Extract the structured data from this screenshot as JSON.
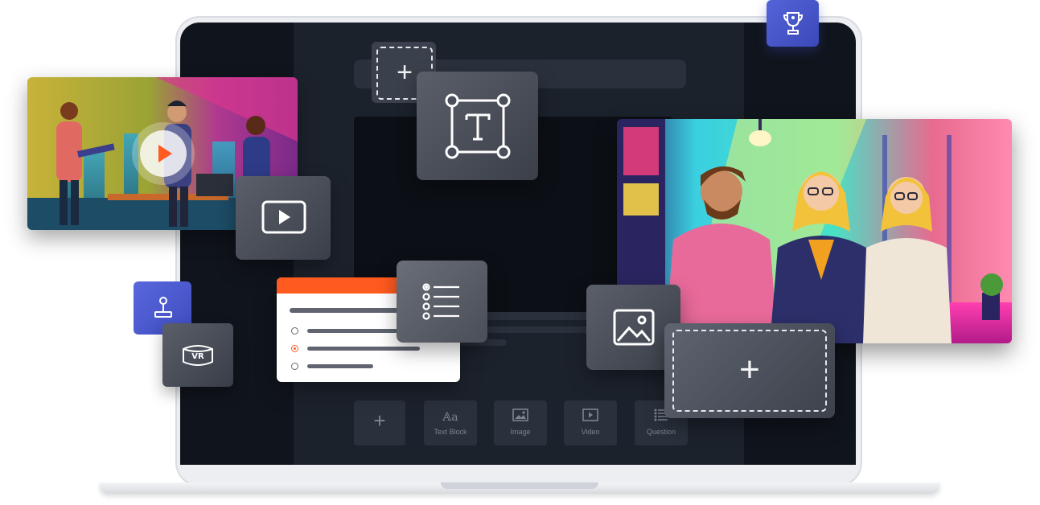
{
  "toolbar": {
    "items": [
      {
        "label": "Text Block",
        "icon": "text-block-icon"
      },
      {
        "label": "Image",
        "icon": "image-icon"
      },
      {
        "label": "Video",
        "icon": "video-icon"
      },
      {
        "label": "Question",
        "icon": "question-list-icon"
      }
    ],
    "add_icon": "plus-icon"
  },
  "icons": {
    "trophy": "trophy-icon",
    "joystick": "joystick-icon",
    "vr": "vr-headset-icon",
    "play": "play-icon",
    "text": "text-frame-icon",
    "list": "checklist-icon",
    "image": "image-icon",
    "add": "plus-icon"
  },
  "colors": {
    "accent": "#ff5a1f",
    "badge_blue": "#4b59cc",
    "screen_dark": "#10141c",
    "panel": "#1c222c"
  }
}
